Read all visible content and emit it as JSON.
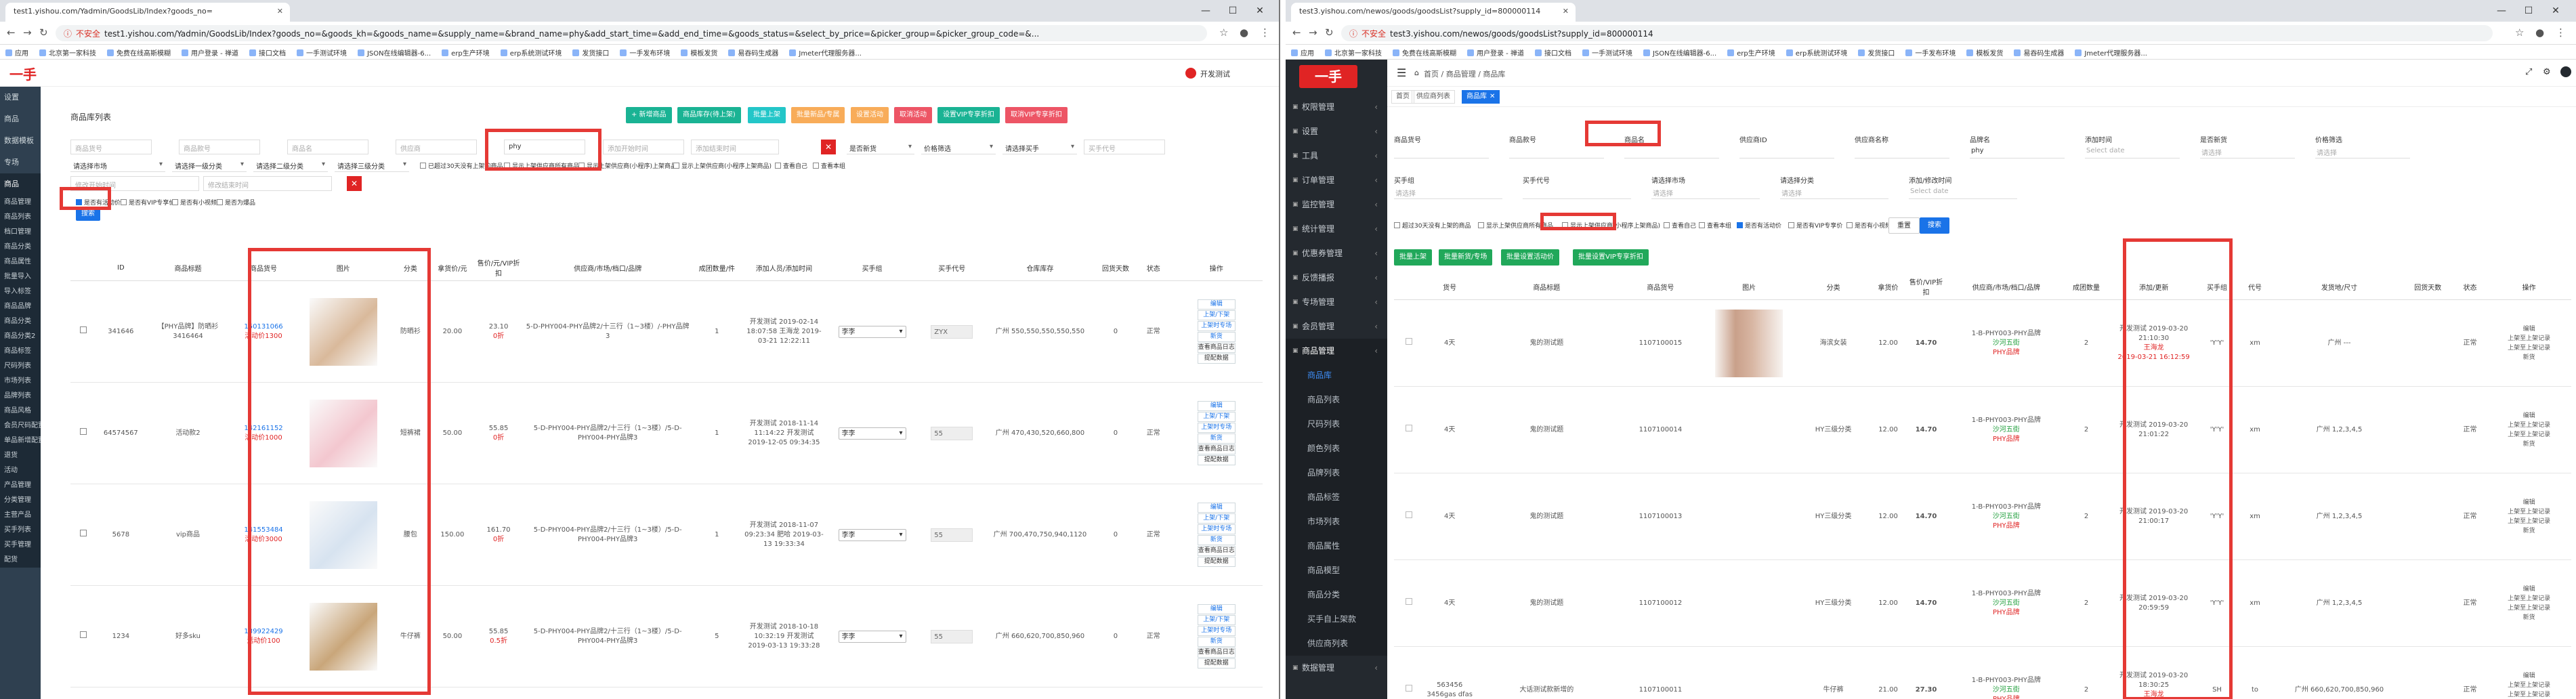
{
  "left_window": {
    "tab_title": "test1.yishou.com/Yadmin/GoodsLib/Index?goods_no=",
    "url": "test1.yishou.com/Yadmin/GoodsLib/Index?goods_no=&goods_kh=&goods_name=&supply_name=&brand_name=phy&add_start_time=&add_end_time=&goods_status=&select_by_price=&picker_group=&picker_group_code=&...",
    "security_label": "不安全",
    "bookmarks": [
      "应用",
      "北京第一家科技",
      "免费在线高斯模糊",
      "用户登录 - 禅道",
      "接口文档",
      "一手测试环境",
      "JSON在线编辑器-6...",
      "erp生产环境",
      "erp系统测试环境",
      "发货接口",
      "一手发布环境",
      "模板发货",
      "易吞码生成器",
      "Jmeter代理服务器..."
    ],
    "app": {
      "logo": "一手",
      "user": "开发测试",
      "sidebar": [
        "设置",
        "商品",
        "数据模板",
        "专场",
        "商品",
        "商品管理",
        "商品列表",
        "档口管理",
        "商品分类",
        "商品属性",
        "批量导入",
        "导入标签",
        "商品品牌",
        "商品分类",
        "商品分类2",
        "商品标签",
        "尺码列表",
        "市场列表",
        "品牌列表",
        "商品风格",
        "会员尺码配置",
        "单品新增配置",
        "退货",
        "活动",
        "产品管理",
        "分类管理",
        "主营产品",
        "买手列表",
        "买手管理",
        "配货"
      ],
      "page_title": "商品库列表",
      "action_buttons": [
        {
          "label": "+ 新增商品",
          "color": "#1ab394"
        },
        {
          "label": "商品库存(待上架)",
          "color": "#1ab394"
        },
        {
          "label": "批量上架",
          "color": "#23c6c8"
        },
        {
          "label": "批量新品/专属",
          "color": "#f8ac59"
        },
        {
          "label": "设置活动",
          "color": "#f8ac59"
        },
        {
          "label": "取消活动",
          "color": "#ed5565"
        },
        {
          "label": "设置VIP专享折扣",
          "color": "#1ab394"
        },
        {
          "label": "取消VIP专享折扣",
          "color": "#ed5565"
        }
      ],
      "filters": {
        "goods_no": "商品货号",
        "goods_kh": "商品款号",
        "goods_name": "商品名",
        "supply_name": "供应商",
        "brand_name": "phy",
        "start_time": "添加开始时间",
        "end_time": "添加结束时间",
        "status": "是否新货",
        "price": "价格筛选",
        "picker": "请选择买手",
        "picker_code": "买手代号",
        "market": "请选择市场",
        "cat1": "请选择一级分类",
        "cat2": "请选择二级分类",
        "cat3": "请选择三级分类",
        "modify_start": "修改开始时间",
        "modify_end": "修改结束时间",
        "search_btn": "搜索"
      },
      "checkboxes_row1": [
        "已超过30天没有上架的商品",
        "显示上架供应商所有商品",
        "显示上架供应商(小程序)上架商品",
        "显示上架供应商(小程序上架商品)",
        "查看自己",
        "查看本组"
      ],
      "checkboxes_row2": [
        "是否有活动价",
        "是否有VIP专享价",
        "是否有小视频",
        "是否为爆品"
      ],
      "table": {
        "headers": [
          "",
          "ID",
          "商品标题",
          "商品货号",
          "图片",
          "分类",
          "拿货价/元",
          "售价/元/VIP折扣",
          "供应商/市场/档口/品牌",
          "成团数量/件",
          "添加人员/添加时间",
          "买手组",
          "买手代号",
          "仓库库存",
          "回货天数",
          "状态",
          "操作"
        ],
        "rows": [
          {
            "id": "341646",
            "title": "【PHY品牌】防晒衫3416464",
            "goods_no": "150131066",
            "promo": "活动价1300",
            "category": "防晒衫",
            "cost": "20.00",
            "price": "23.10",
            "vip": "0折",
            "supplier": "5-D-PHY004-PHY品牌2/十三行（1~3楼）/-PHY品牌3",
            "group_qty": "1",
            "added": "开发测试 2019-02-14 18:07:58 王海龙 2019-03-21 12:22:11",
            "picker": "李李",
            "code": "ZYX",
            "stock": "广州 550,550,550,550,550",
            "days": "0",
            "status": "正常"
          },
          {
            "id": "64574567",
            "title": "活动款2",
            "goods_no": "142161152",
            "promo": "活动价1000",
            "category": "短裤裙",
            "cost": "50.00",
            "price": "55.85",
            "vip": "0折",
            "supplier": "5-D-PHY004-PHY品牌2/十三行（1~3楼）/5-D-PHY004-PHY品牌3",
            "group_qty": "1",
            "added": "开发测试 2018-11-14 11:14:22 开发测试 2019-12-05 09:34:35",
            "picker": "李李",
            "code": "55",
            "stock": "广州 470,430,520,660,800",
            "days": "0",
            "status": "正常"
          },
          {
            "id": "5678",
            "title": "vip商品",
            "goods_no": "141553484",
            "promo": "活动价3000",
            "category": "腰包",
            "cost": "150.00",
            "price": "161.70",
            "vip": "0折",
            "supplier": "5-D-PHY004-PHY品牌2/十三行（1~3楼）/5-D-PHY004-PHY品牌3",
            "group_qty": "1",
            "added": "开发测试 2018-11-07 09:23:34 肥哈 2019-03-13 19:33:34",
            "picker": "李李",
            "code": "55",
            "stock": "广州 700,470,750,940,1120",
            "days": "0",
            "status": "正常"
          },
          {
            "id": "1234",
            "title": "好多sku",
            "goods_no": "139922429",
            "promo": "活动价100",
            "category": "牛仔裤",
            "cost": "50.00",
            "price": "55.85",
            "vip": "0.5折",
            "supplier": "5-D-PHY004-PHY品牌2/十三行（1~3楼）/5-D-PHY004-PHY品牌3",
            "group_qty": "5",
            "added": "开发测试 2018-10-18 10:32:19 开发测试 2019-03-13 19:33:28",
            "picker": "李李",
            "code": "55",
            "stock": "广州 660,620,700,850,960",
            "days": "0",
            "status": "正常"
          }
        ],
        "ops": [
          "编辑",
          "上架/下架",
          "上架时专场",
          "新货",
          "查看商品日志",
          "提配数据"
        ]
      }
    }
  },
  "right_window": {
    "tab_title": "test3.yishou.com/newos/goods/goodsList?supply_id=800000114",
    "url": "test3.yishou.com/newos/goods/goodsList?supply_id=800000114",
    "security_label": "不安全",
    "bookmarks": [
      "应用",
      "北京第一家科技",
      "免费在线高斯模糊",
      "用户登录 - 禅道",
      "接口文档",
      "一手测试环境",
      "JSON在线编辑器-6...",
      "erp生产环境",
      "erp系统测试环境",
      "发货接口",
      "一手发布环境",
      "模板发货",
      "易吞码生成器",
      "Jmeter代理服务器..."
    ],
    "app": {
      "logo": "一手",
      "breadcrumb": [
        "首页",
        "商品管理",
        "商品库"
      ],
      "tabs": [
        "首页",
        "供应商列表",
        "商品库"
      ],
      "sidebar_groups": [
        "权限管理",
        "设置",
        "工具",
        "订单管理",
        "监控管理",
        "统计管理",
        "优惠券管理",
        "反馈播报",
        "专场管理",
        "会员管理",
        "商品管理"
      ],
      "sidebar_sub": [
        "商品库",
        "商品列表",
        "尺码列表",
        "颜色列表",
        "品牌列表",
        "商品标签",
        "市场列表",
        "商品属性",
        "商品模型",
        "商品分类",
        "买手自上架款",
        "供应商列表"
      ],
      "sidebar_after": [
        "数据管理"
      ],
      "filters": [
        {
          "label": "商品货号",
          "value": ""
        },
        {
          "label": "商品款号",
          "value": ""
        },
        {
          "label": "商品名",
          "value": ""
        },
        {
          "label": "供应商ID",
          "value": ""
        },
        {
          "label": "供应商名称",
          "value": ""
        },
        {
          "label": "品牌名",
          "value": "phy"
        },
        {
          "label": "添加时间",
          "value": "Select date"
        },
        {
          "label": "是否新货",
          "value": "请选择"
        },
        {
          "label": "价格筛选",
          "value": "请选择"
        }
      ],
      "filters_row2": [
        {
          "label": "买手组",
          "value": "请选择"
        },
        {
          "label": "买手代号",
          "value": ""
        },
        {
          "label": "请选择市场",
          "value": "请选择"
        },
        {
          "label": "请选择分类",
          "value": "请选择"
        },
        {
          "label": "添加/修改时间",
          "value": "Select date"
        }
      ],
      "checkboxes": [
        "超过30天没有上架的商品",
        "显示上架供应商所有商品",
        "显示上架供应商(小程序上架商品)",
        "查看自己",
        "查看本组",
        "是否有活动价",
        "是否有VIP专享价",
        "是否有小视频",
        "是否为爆品"
      ],
      "reset_btn": "重置",
      "search_btn": "搜索",
      "action_buttons": [
        "批量上架",
        "批量新货/专场",
        "批量设置活动价",
        "批量设置VIP专享折扣"
      ],
      "table": {
        "headers": [
          "",
          "货号",
          "商品标题",
          "商品货号",
          "图片",
          "分类",
          "拿货价",
          "售价/VIP折扣",
          "供应商/市场/档口/品牌",
          "成团数量",
          "添加/更新",
          "买手组",
          "代号",
          "发货地/尺寸",
          "回货天数",
          "状态",
          "操作"
        ],
        "rows": [
          {
            "days": "4天",
            "title": "鬼的测试题",
            "goods_no": "1107100015",
            "category": "海滨女装",
            "cost": "12.00",
            "price": "14.70",
            "supplier": "1-B-PHY003-PHY品牌",
            "market": "沙河五街",
            "brand": "PHY品牌",
            "qty": "2",
            "added": "开发测试 2019-03-20 21:10:30",
            "updater": "王海龙",
            "updated": "2019-03-21 16:12:59",
            "group": "'Y'Y'",
            "code": "xm",
            "ship": "广州 ---",
            "status": "正常"
          },
          {
            "days": "4天",
            "title": "鬼的测试题",
            "goods_no": "1107100014",
            "category": "HY三级分类",
            "cost": "12.00",
            "price": "14.70",
            "supplier": "1-B-PHY003-PHY品牌",
            "market": "沙河五街",
            "brand": "PHY品牌",
            "qty": "2",
            "added": "开发测试 2019-03-20 21:01:22",
            "updater": "",
            "updated": "",
            "group": "'Y'Y'",
            "code": "xm",
            "ship": "广州 1,2,3,4,5",
            "status": "正常"
          },
          {
            "days": "4天",
            "title": "鬼的测试题",
            "goods_no": "1107100013",
            "category": "HY三级分类",
            "cost": "12.00",
            "price": "14.70",
            "supplier": "1-B-PHY003-PHY品牌",
            "market": "沙河五街",
            "brand": "PHY品牌",
            "qty": "2",
            "added": "开发测试 2019-03-20 21:00:17",
            "updater": "",
            "updated": "",
            "group": "'Y'Y'",
            "code": "xm",
            "ship": "广州 1,2,3,4,5",
            "status": "正常"
          },
          {
            "days": "4天",
            "title": "鬼的测试题",
            "goods_no": "1107100012",
            "category": "HY三级分类",
            "cost": "12.00",
            "price": "14.70",
            "supplier": "1-B-PHY003-PHY品牌",
            "market": "沙河五街",
            "brand": "PHY品牌",
            "qty": "2",
            "added": "开发测试 2019-03-20 20:59:59",
            "updater": "",
            "updated": "",
            "group": "'Y'Y'",
            "code": "xm",
            "ship": "广州 1,2,3,4,5",
            "status": "正常"
          },
          {
            "days": "4天",
            "title": "大话测试款新增的",
            "goods_no": "1107100011",
            "category": "牛仔裤",
            "cost": "21.00",
            "price": "27.30",
            "supplier": "1-B-PHY003-PHY品牌",
            "market": "沙河五街",
            "brand": "PHY品牌",
            "qty": "2",
            "added": "开发测试 2019-03-20 18:30:25",
            "updater": "王海龙",
            "updated": "2019-03-21 19:34:15",
            "group": "SH",
            "code": "to",
            "ship": "广州 660,620,700,850,960",
            "status": "正常",
            "prefix": "563456 3456gas dfas"
          }
        ],
        "ops": [
          "编辑",
          "上架至上架记录",
          "上架至上架记录",
          "新货"
        ]
      }
    }
  },
  "colors": {
    "red": "#e53935",
    "accent": "#1a73e8",
    "green": "#21a85a",
    "sidebar_dark": "#2f4050",
    "sidebar_right": "#24292f"
  }
}
